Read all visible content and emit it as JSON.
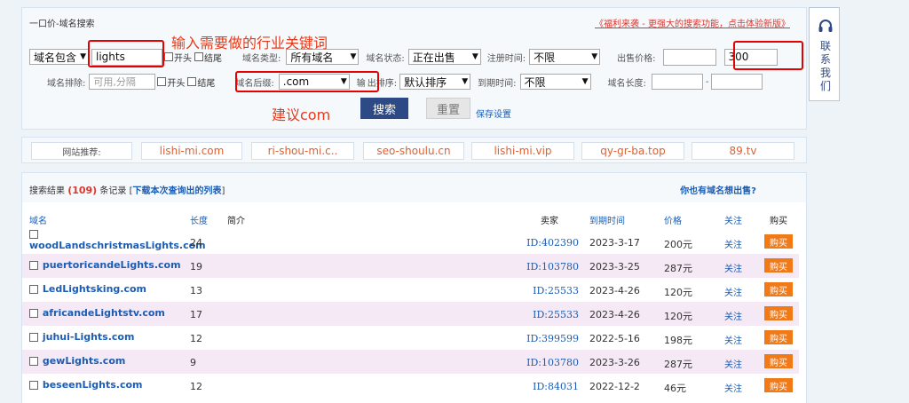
{
  "search": {
    "title": "一口价-域名搜索",
    "promo_link": "《福利来袭 - 更强大的搜索功能，点击体验新版》",
    "match_type": "域名包含",
    "keyword": "lights",
    "start_label": "开头",
    "end_label": "结尾",
    "domain_type_label": "域名类型:",
    "domain_type_value": "所有域名",
    "domain_status_label": "域名状态:",
    "domain_status_value": "正在出售",
    "reg_time_label": "注册时间:",
    "reg_time_value": "不限",
    "price_label": "出售价格:",
    "price_min": "",
    "price_max": "300",
    "exclude_label": "域名排除:",
    "exclude_placeholder": "可用,分隔",
    "suffix_label": "域名后缀:",
    "suffix_value": ".com",
    "sort_label_a": "输",
    "sort_label_b": "出排序:",
    "sort_value": "默认排序",
    "expire_label": "到期时间:",
    "expire_value": "不限",
    "length_label": "域名长度:",
    "length_min": "",
    "length_sep": "-",
    "length_max": "",
    "search_button": "搜索",
    "reset_button": "重置",
    "save_link": "保存设置"
  },
  "annotations": {
    "keyword_hint": "输入需要做的行业关键词",
    "suffix_hint": "建议com"
  },
  "recommend": {
    "label": "网站推荐:",
    "sites": [
      "lishi-mi.com",
      "ri-shou-mi.c..",
      "seo-shoulu.cn",
      "lishi-mi.vip",
      "qy-gr-ba.top",
      "89.tv"
    ]
  },
  "results": {
    "prefix": "搜索结果",
    "count": "(109)",
    "suffix": "条记录 [",
    "download_link": "下载本次查询出的列表",
    "suffix_end": "]",
    "sell_question": "你也有域名想出售?",
    "headers": {
      "domain": "域名",
      "length": "长度",
      "intro": "简介",
      "seller": "卖家",
      "expiry": "到期时间",
      "price": "价格",
      "follow": "关注",
      "buy": "购买"
    },
    "rows": [
      {
        "domain": "woodLandschristmasLights.com",
        "length": "24",
        "seller": "ID:402390",
        "expiry": "2023-3-17",
        "price": "200元",
        "follow": "关注",
        "buy": "购买"
      },
      {
        "domain": "puertoricandeLights.com",
        "length": "19",
        "seller": "ID:103780",
        "expiry": "2023-3-25",
        "price": "287元",
        "follow": "关注",
        "buy": "购买"
      },
      {
        "domain": "LedLightsking.com",
        "length": "13",
        "seller": "ID:25533",
        "expiry": "2023-4-26",
        "price": "120元",
        "follow": "关注",
        "buy": "购买"
      },
      {
        "domain": "africandeLightstv.com",
        "length": "17",
        "seller": "ID:25533",
        "expiry": "2023-4-26",
        "price": "120元",
        "follow": "关注",
        "buy": "购买"
      },
      {
        "domain": "juhui-Lights.com",
        "length": "12",
        "seller": "ID:399599",
        "expiry": "2022-5-16",
        "price": "198元",
        "follow": "关注",
        "buy": "购买"
      },
      {
        "domain": "gewLights.com",
        "length": "9",
        "seller": "ID:103780",
        "expiry": "2023-3-26",
        "price": "287元",
        "follow": "关注",
        "buy": "购买"
      },
      {
        "domain": "beseenLights.com",
        "length": "12",
        "seller": "ID:84031",
        "expiry": "2022-12-2",
        "price": "46元",
        "follow": "关注",
        "buy": "购买"
      }
    ]
  },
  "contact": {
    "label": "联系我们"
  },
  "colors": {
    "accent_red": "#e60000",
    "link_blue": "#1c5db3",
    "buy_orange": "#f07a18",
    "search_btn": "#2d4a87"
  }
}
